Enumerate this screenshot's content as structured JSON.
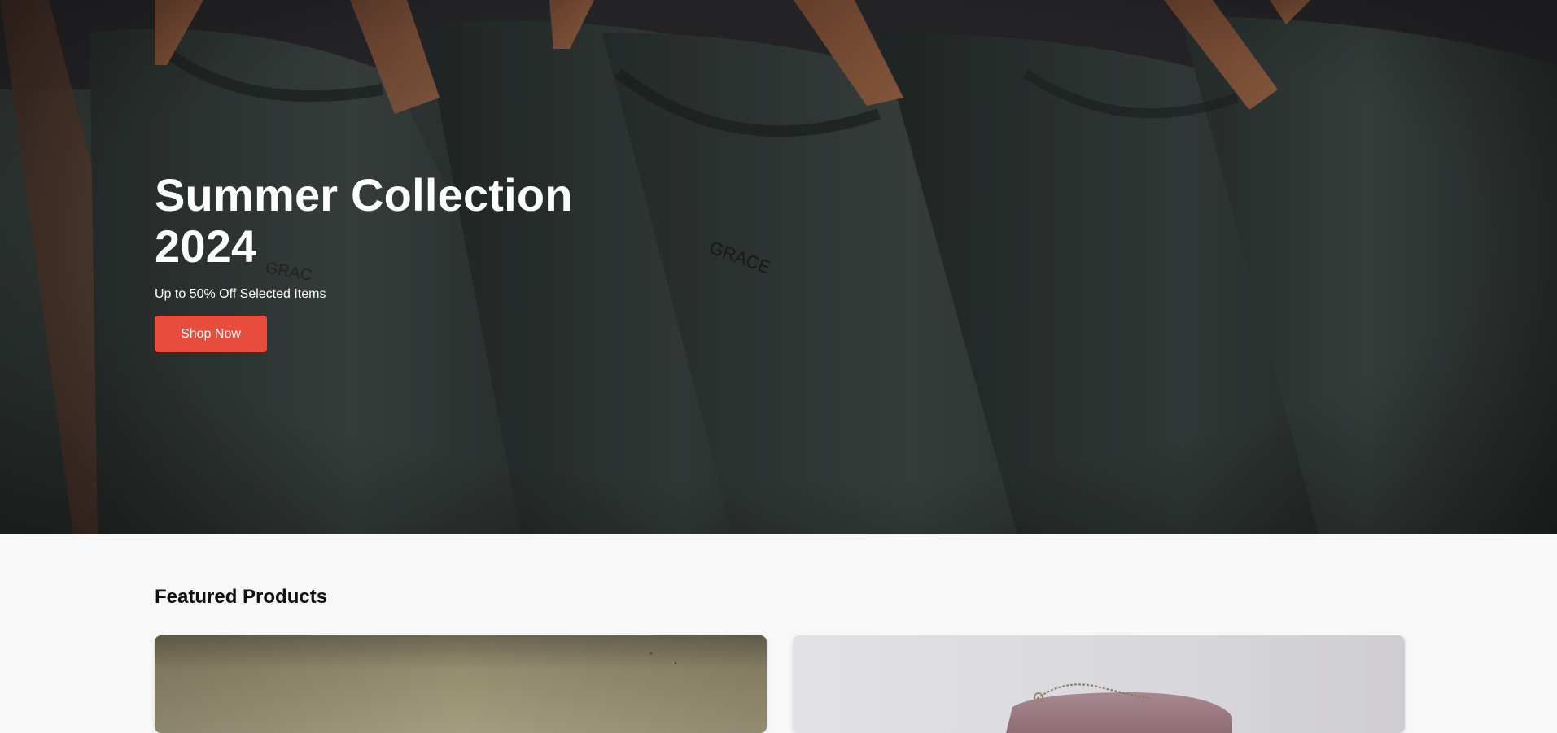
{
  "hero": {
    "title": "Summer Collection 2024",
    "subtitle": "Up to 50% Off Selected Items",
    "cta_label": "Shop Now",
    "accent_color": "#e74c3c"
  },
  "featured": {
    "title": "Featured Products"
  }
}
